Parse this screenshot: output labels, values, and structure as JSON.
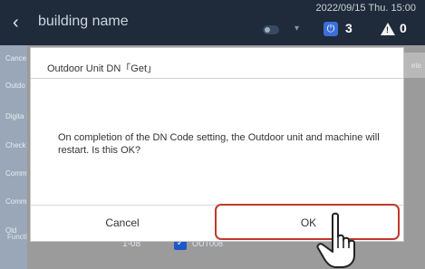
{
  "header": {
    "title": "building name",
    "datetime": "2022/09/15 Thu. 15:00",
    "power_count": "3",
    "warning_count": "0"
  },
  "sidebar": {
    "items": [
      "Cance",
      "Outdo",
      "Digita",
      "Check",
      "Comm",
      "Comm",
      "Old"
    ],
    "function_settings": "Function settings"
  },
  "background": {
    "right_button_text": "ete",
    "row_id": "1-08",
    "row_unit": "OUT008"
  },
  "dialog": {
    "title": "Outdoor Unit DN「Get」",
    "message": "On completion of the DN Code setting, the Outdoor unit and machine will restart. Is this OK?",
    "cancel_label": "Cancel",
    "ok_label": "OK"
  },
  "icons": {
    "back": "back-chevron-icon",
    "power": "power-icon",
    "warning": "warning-icon",
    "cursor": "hand-pointer-icon"
  },
  "colors": {
    "header_bg": "#1f2a3a",
    "accent_blue": "#3b6fd8",
    "highlight_red": "#c0392b"
  }
}
